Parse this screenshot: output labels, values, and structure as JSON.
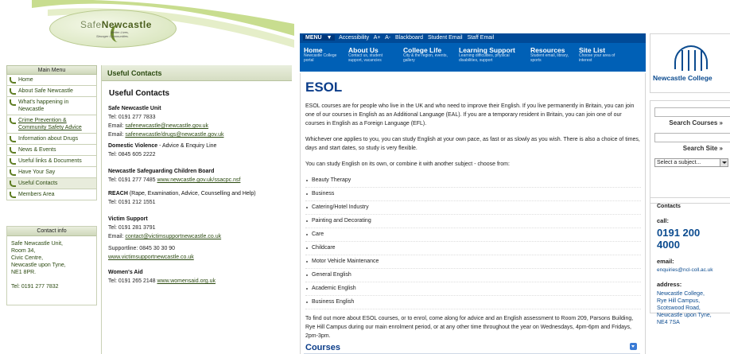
{
  "snc": {
    "logo_a": "Safe",
    "logo_b": "Newcastle",
    "tagline1": "Better Lives,",
    "tagline2": "Stronger Communities.",
    "main_menu_title": "Main Menu",
    "menu": [
      {
        "label": "Home"
      },
      {
        "label": "About Safe Newcastle"
      },
      {
        "label": "What's happening in Newcastle"
      },
      {
        "label": "Crime Prevention & Community Safety Advice"
      },
      {
        "label": "Information about Drugs"
      },
      {
        "label": "News & Events"
      },
      {
        "label": "Useful links & Documents"
      },
      {
        "label": "Have Your Say"
      },
      {
        "label": "Useful Contacts"
      },
      {
        "label": "Members Area"
      }
    ],
    "contact_info": {
      "title": "Contact info",
      "lines": [
        "Safe Newcastle Unit,",
        "Room 34,",
        "Civic Centre,",
        "Newcastle upon Tyne,",
        "NE1 8PR."
      ],
      "tel": "Tel: 0191 277 7832"
    },
    "useful_contacts": {
      "header": "Useful Contacts",
      "heading": "Useful Contacts",
      "unit_name": "Safe Newcastle Unit",
      "unit_tel": "Tel: 0191 277 7833",
      "unit_email1_label": "Email: ",
      "unit_email1": "safenewcastle@newcastle.gov.uk",
      "unit_email2_label": "Email: ",
      "unit_email2": "safenewcastle/drugs@newcastle.gov.uk",
      "dv_name": "Domestic Violence",
      "dv_rest": " - Advice & Enquiry Line",
      "dv_tel": "Tel: 0845 605 2222",
      "nscb_name": "Newcastle Safeguarding Children Board",
      "nscb_tel": "Tel: 0191 277 7485 ",
      "nscb_link": "www.newcastle.gov.uk/ssacpc.nsf",
      "reach_name": "REACH",
      "reach_rest": " (Rape, Examination, Advice, Counselling and Help)",
      "reach_tel": "Tel: 0191 212 1551",
      "vs_name": "Victim Support",
      "vs_tel": "Tel: 0191 281 3791",
      "vs_email_label": "Email: ",
      "vs_email": "contact@victimsupportnewcastle.co.uk",
      "vs_supportline": "Supportline: 0845 30 30 90",
      "vs_web": "www.victimsupportnewcastle.co.uk",
      "wa_name": "Women's Aid",
      "wa_tel": "Tel: 0191 265 2148 ",
      "wa_web": "www.womensaid.org.uk"
    }
  },
  "nc": {
    "menubar": [
      "Accessibility",
      "A+",
      "A-",
      "Blackboard",
      "Student Email",
      "Staff Email"
    ],
    "menu_label": "MENU",
    "nav": [
      {
        "title": "Home",
        "sub": "Newcastle College portal"
      },
      {
        "title": "About Us",
        "sub": "Contact us, student support, vacancies"
      },
      {
        "title": "College Life",
        "sub": "City & the region, events, gallery"
      },
      {
        "title": "Learning Support",
        "sub": "Learning difficulties, physical disabilities, support"
      },
      {
        "title": "Resources",
        "sub": "Student email, library, sports"
      },
      {
        "title": "Site List",
        "sub": "Choose your area of interest"
      }
    ],
    "title": "ESOL",
    "para1": "ESOL courses are for people who live in the UK and who need to improve their English. If you live permanently in Britain, you can join one of our courses in English as an Additional Language (EAL). If you are a temporary resident in Britain, you can join one of our courses in English as a Foreign Language (EFL).",
    "para2": "Whichever one applies to you, you can study English at your own pace, as fast or as slowly as you wish. There is also a choice of times, days and start dates, so study is very flexible.",
    "para3": "You can study English on its own, or combine it with another subject - choose from:",
    "subjects": [
      "Beauty Therapy",
      "Business",
      "Catering/Hotel Industry",
      "Painting and Decorating",
      "Care",
      "Childcare",
      "Motor Vehicle Maintenance",
      "General English",
      "Academic English",
      "Business English"
    ],
    "para4": "To find out more about ESOL courses, or to enrol, come along for advice and an English assessment to Room 209, Parsons Building, Rye Hill Campus during our main enrolment period, or at any other time throughout the year on Wednesdays, 4pm-6pm and Fridays, 2pm-3pm.",
    "courses": "Courses",
    "logo_name": "Newcastle College",
    "search_courses": "Search Courses »",
    "search_site": "Search Site »",
    "select_subject": "Select a subject...",
    "contacts": {
      "heading": "Contacts",
      "call_label": "call:",
      "phone": "0191 200 4000",
      "email_label": "email:",
      "email": "enquiries@ncl-coll.ac.uk",
      "address_label": "address:",
      "address": [
        "Newcastle College,",
        "Rye Hill Campus,",
        "Scotswood Road,",
        "Newcastle upon Tyne,",
        "NE4 7SA"
      ]
    }
  },
  "colors": {
    "snc_green": "#2b4a10",
    "nc_blue": "#004a97",
    "nc_nav": "#0060b6"
  }
}
